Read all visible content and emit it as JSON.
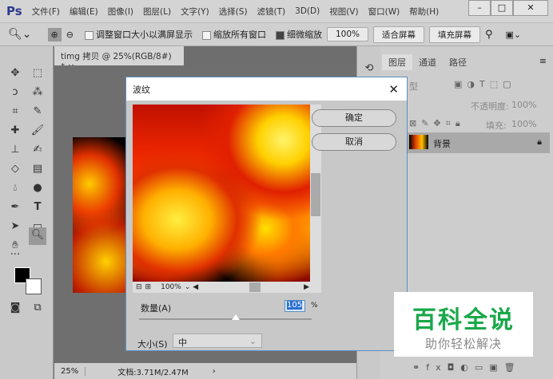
{
  "app": {
    "logo": "Ps",
    "menus": [
      "文件(F)",
      "编辑(E)",
      "图像(I)",
      "图层(L)",
      "文字(Y)",
      "选择(S)",
      "滤镜(T)",
      "3D(D)",
      "视图(V)",
      "窗口(W)",
      "帮助(H)"
    ]
  },
  "options": {
    "resize_windows": "调整窗口大小以满屏显示",
    "zoom_all": "缩放所有窗口",
    "scrubby_zoom": "细微缩放",
    "zoom_value": "100%",
    "fit_screen": "适合屏幕",
    "fill_screen": "填充屏幕"
  },
  "document": {
    "tab_title": "timg 拷贝 @ 25%(RGB/8#) *",
    "close": "×",
    "zoom": "25%",
    "doc_size": "文档:3.71M/2.47M"
  },
  "layers_panel": {
    "tabs": [
      "图层",
      "通道",
      "路径"
    ],
    "kind": "型",
    "opacity_label": "不透明度:",
    "opacity": "100%",
    "fill_label": "填充:",
    "fill": "100%",
    "layer_name": "背景"
  },
  "dialog": {
    "title": "波纹",
    "ok": "确定",
    "cancel": "取消",
    "preview_zoom": "100%",
    "amount_label": "数量(A)",
    "amount": "105",
    "amount_unit": "%",
    "amount_slider_fraction": 0.56,
    "size_label": "大小(S)",
    "size_value": "中"
  },
  "watermark": {
    "title": "百科全说",
    "subtitle": "助你轻松解决",
    "color": "#1aa84a"
  }
}
